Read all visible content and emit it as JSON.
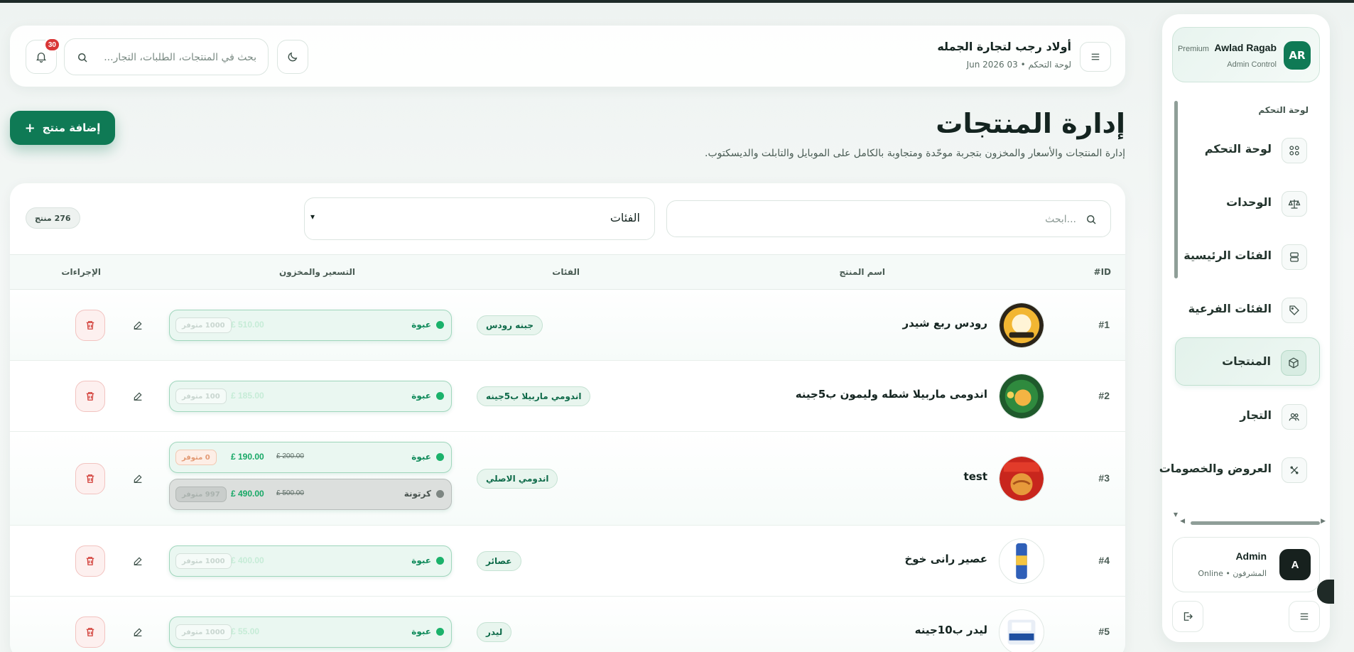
{
  "colors": {
    "accent": "#0f7a55",
    "danger": "#d93636",
    "chip": "#e8f5ee"
  },
  "sidebar": {
    "brand": {
      "avatar": "AR",
      "name": "Awlad Ragab",
      "badge": "Premium",
      "subtitle": "Admin Control"
    },
    "section_label": "لوحة التحكم",
    "items": [
      {
        "label": "لوحة التحكم",
        "icon": "grid-icon",
        "active": false
      },
      {
        "label": "الوحدات",
        "icon": "scale-icon",
        "active": false
      },
      {
        "label": "الفئات الرئيسية",
        "icon": "layout-icon",
        "active": false
      },
      {
        "label": "الفئات الفرعية",
        "icon": "tag-icon",
        "active": false
      },
      {
        "label": "المنتجات",
        "icon": "box-icon",
        "active": true
      },
      {
        "label": "التجار",
        "icon": "users-icon",
        "active": false
      },
      {
        "label": "العروض والخصومات",
        "icon": "percent-icon",
        "active": false
      }
    ],
    "user": {
      "avatar": "A",
      "name": "Admin",
      "status": "المشرفون • Online"
    }
  },
  "header": {
    "store_title": "أولاد رجب لتجارة الجمله",
    "store_subtitle": "لوحة التحكم • 03 Jun 2026",
    "search_placeholder": "بحث في المنتجات، الطلبات، التجار...",
    "notification_count": "30"
  },
  "page": {
    "title": "إدارة المنتجات",
    "description": "إدارة المنتجات والأسعار والمخزون بتجربة موحّدة ومتجاوبة بالكامل على الموبايل والتابلت والديسكتوب.",
    "add_button": "إضافة منتج",
    "add_button_icon": "plus-icon"
  },
  "filters": {
    "search_placeholder": "...ابحث",
    "category_select": "الفئات",
    "count": "276 منتج"
  },
  "table": {
    "columns": {
      "id": "ID#",
      "name": "اسم المنتج",
      "category": "الفئات",
      "pricing": "التسعير والمخزون",
      "actions": "الإجراءات"
    },
    "rows": [
      {
        "id": "#1",
        "name": "رودس ربع شيدر",
        "category": "جبنه رودس",
        "prices": [
          {
            "unit": "عبوة",
            "old": "",
            "new": "£ 510.00",
            "stock": "1000 متوفر",
            "active": true,
            "faded": true
          }
        ]
      },
      {
        "id": "#2",
        "name": "اندومى ماربيلا شطه وليمون ب5جينه",
        "category": "اندومي ماربيلا ب5جينه",
        "prices": [
          {
            "unit": "عبوة",
            "old": "",
            "new": "£ 185.00",
            "stock": "100 متوفر",
            "active": true,
            "faded": true
          }
        ]
      },
      {
        "id": "#3",
        "name": "test",
        "category": "اندومي الاصلي",
        "prices": [
          {
            "unit": "عبوة",
            "old": "£ 200.00",
            "new": "£ 190.00",
            "stock": "0 متوفر",
            "active": true,
            "faded": false
          },
          {
            "unit": "كرتونة",
            "old": "£ 500.00",
            "new": "£ 490.00",
            "stock": "997 متوفر",
            "active": false,
            "faded": false
          }
        ]
      },
      {
        "id": "#4",
        "name": "عصير رانى خوخ",
        "category": "عصائر",
        "prices": [
          {
            "unit": "عبوة",
            "old": "",
            "new": "£ 400.00",
            "stock": "1000 متوفر",
            "active": true,
            "faded": true
          }
        ]
      },
      {
        "id": "#5",
        "name": "ليدر ب10جينه",
        "category": "ليدر",
        "prices": [
          {
            "unit": "عبوة",
            "old": "",
            "new": "£ 55.00",
            "stock": "1000 متوفر",
            "active": true,
            "faded": true
          }
        ]
      }
    ]
  }
}
